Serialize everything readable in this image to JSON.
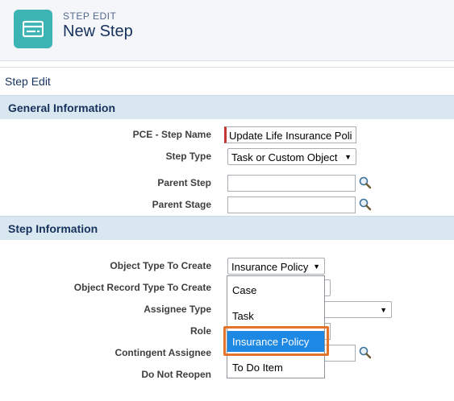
{
  "header": {
    "kicker": "STEP EDIT",
    "title": "New Step",
    "icon": "step-record-icon",
    "icon_color": "#3cb4b4"
  },
  "page_label": "Step Edit",
  "sections": {
    "general": "General Information",
    "step": "Step Information"
  },
  "fields": {
    "step_name": {
      "label": "PCE - Step Name",
      "value": "Update Life Insurance Poli"
    },
    "step_type": {
      "label": "Step Type",
      "value": "Task or Custom Object"
    },
    "parent_step": {
      "label": "Parent Step",
      "value": ""
    },
    "parent_stage": {
      "label": "Parent Stage",
      "value": ""
    },
    "object_type": {
      "label": "Object Type To Create",
      "value": "Insurance Policy"
    },
    "object_record_type": {
      "label": "Object Record Type To Create"
    },
    "assignee_type": {
      "label": "Assignee Type"
    },
    "role": {
      "label": "Role"
    },
    "contingent_assignee": {
      "label": "Contingent Assignee"
    },
    "do_not_reopen": {
      "label": "Do Not Reopen"
    }
  },
  "dropdown": {
    "options": [
      "Case",
      "Task",
      "Insurance Policy",
      "To Do Item"
    ],
    "selected": "Insurance Policy",
    "highlight_color": "#e2742c",
    "selected_color": "#1e88e5"
  }
}
